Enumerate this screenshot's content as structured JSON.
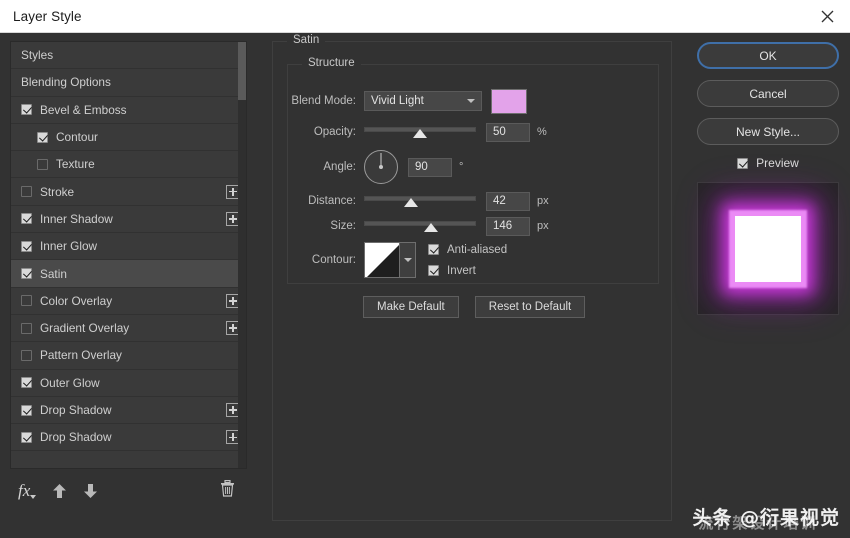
{
  "window": {
    "title": "Layer Style",
    "close_icon": "close-icon"
  },
  "styles_list": {
    "items": [
      {
        "label": "Styles",
        "checkbox": "none",
        "indent": false,
        "plus": false,
        "selected": false
      },
      {
        "label": "Blending Options",
        "checkbox": "none",
        "indent": false,
        "plus": false,
        "selected": false
      },
      {
        "label": "Bevel & Emboss",
        "checkbox": "checked",
        "indent": false,
        "plus": false,
        "selected": false
      },
      {
        "label": "Contour",
        "checkbox": "checked",
        "indent": true,
        "plus": false,
        "selected": false
      },
      {
        "label": "Texture",
        "checkbox": "unchecked",
        "indent": true,
        "plus": false,
        "selected": false
      },
      {
        "label": "Stroke",
        "checkbox": "unchecked",
        "indent": false,
        "plus": true,
        "selected": false
      },
      {
        "label": "Inner Shadow",
        "checkbox": "checked",
        "indent": false,
        "plus": true,
        "selected": false
      },
      {
        "label": "Inner Glow",
        "checkbox": "checked",
        "indent": false,
        "plus": false,
        "selected": false
      },
      {
        "label": "Satin",
        "checkbox": "checked",
        "indent": false,
        "plus": false,
        "selected": true
      },
      {
        "label": "Color Overlay",
        "checkbox": "unchecked",
        "indent": false,
        "plus": true,
        "selected": false
      },
      {
        "label": "Gradient Overlay",
        "checkbox": "unchecked",
        "indent": false,
        "plus": true,
        "selected": false
      },
      {
        "label": "Pattern Overlay",
        "checkbox": "unchecked",
        "indent": false,
        "plus": false,
        "selected": false
      },
      {
        "label": "Outer Glow",
        "checkbox": "checked",
        "indent": false,
        "plus": false,
        "selected": false
      },
      {
        "label": "Drop Shadow",
        "checkbox": "checked",
        "indent": false,
        "plus": true,
        "selected": false
      },
      {
        "label": "Drop Shadow",
        "checkbox": "checked",
        "indent": false,
        "plus": true,
        "selected": false
      }
    ]
  },
  "toolbar": {
    "fx_label": "fx",
    "move_up_icon": "arrow-up-icon",
    "move_down_icon": "arrow-down-icon",
    "delete_icon": "trash-icon"
  },
  "panel": {
    "section_title": "Satin",
    "group_title": "Structure",
    "blend_mode": {
      "label": "Blend Mode:",
      "value": "Vivid Light",
      "color": "#e3a3ea"
    },
    "opacity": {
      "label": "Opacity:",
      "value": "50",
      "unit": "%",
      "slider_percent": 50
    },
    "angle": {
      "label": "Angle:",
      "value": "90",
      "unit": "°",
      "degrees": 90
    },
    "distance": {
      "label": "Distance:",
      "value": "42",
      "unit": "px",
      "slider_percent": 42
    },
    "size": {
      "label": "Size:",
      "value": "146",
      "unit": "px",
      "slider_percent": 60
    },
    "contour": {
      "label": "Contour:",
      "anti_aliased_label": "Anti-aliased",
      "anti_aliased_checked": true,
      "invert_label": "Invert",
      "invert_checked": true
    },
    "make_default_label": "Make Default",
    "reset_default_label": "Reset to Default"
  },
  "actions": {
    "ok_label": "OK",
    "cancel_label": "Cancel",
    "new_style_label": "New Style...",
    "preview_label": "Preview",
    "preview_checked": true
  },
  "watermark": {
    "main": "头条 @衍果视觉",
    "sub": "流行架设计培训"
  }
}
